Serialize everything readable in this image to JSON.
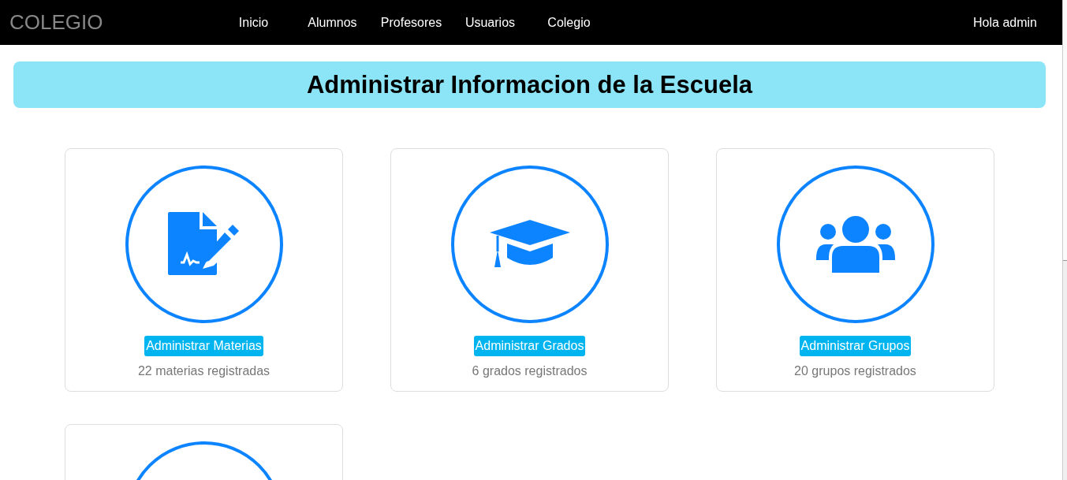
{
  "navbar": {
    "brand": "COLEGIO",
    "links": [
      "Inicio",
      "Alumnos",
      "Profesores",
      "Usuarios",
      "Colegio"
    ],
    "greeting": "Hola admin"
  },
  "banner": {
    "title": "Administrar Informacion de la Escuela"
  },
  "cards": [
    {
      "kind": "document",
      "button": "Administrar Materias",
      "caption": "22 materias registradas"
    },
    {
      "kind": "cap",
      "button": "Administrar Grados",
      "caption": "6 grados registrados"
    },
    {
      "kind": "people",
      "button": "Administrar Grupos",
      "caption": "20 grupos registrados"
    },
    {
      "kind": "hidden"
    }
  ]
}
